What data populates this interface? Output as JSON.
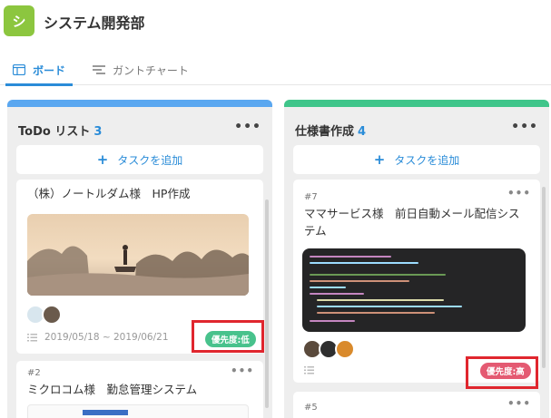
{
  "app": {
    "logo_letter": "シ",
    "project_title": "システム開発部"
  },
  "tabs": [
    {
      "label": "ボード",
      "icon": "board-icon",
      "active": true
    },
    {
      "label": "ガントチャート",
      "icon": "gantt-icon",
      "active": false
    }
  ],
  "columns": [
    {
      "title": "ToDo リスト",
      "count": "3",
      "color": "#5aa7f0",
      "more": "•••",
      "add_label": "タスクを追加",
      "cards": [
        {
          "title": "（株）ノートルダム様　HP作成",
          "dates": "2019/05/18 ~ 2019/06/21",
          "priority": "優先度:低",
          "priority_color": "#48c28c",
          "more": "•••"
        },
        {
          "id": "#2",
          "title": "ミクロコム様　勤怠管理システム",
          "more": "•••"
        }
      ]
    },
    {
      "title": "仕様書作成",
      "count": "4",
      "color": "#3fc58a",
      "more": "•••",
      "add_label": "タスクを追加",
      "cards": [
        {
          "id": "#7",
          "title": "ママサービス様　前日自動メール配信システム",
          "priority": "優先度:高",
          "priority_color": "#e45a72",
          "more": "•••"
        },
        {
          "id": "#5",
          "more": "•••"
        }
      ]
    }
  ],
  "colors": {
    "accent": "#2a8cd8",
    "highlight": "#e0262e",
    "logo": "#8cc63f"
  }
}
